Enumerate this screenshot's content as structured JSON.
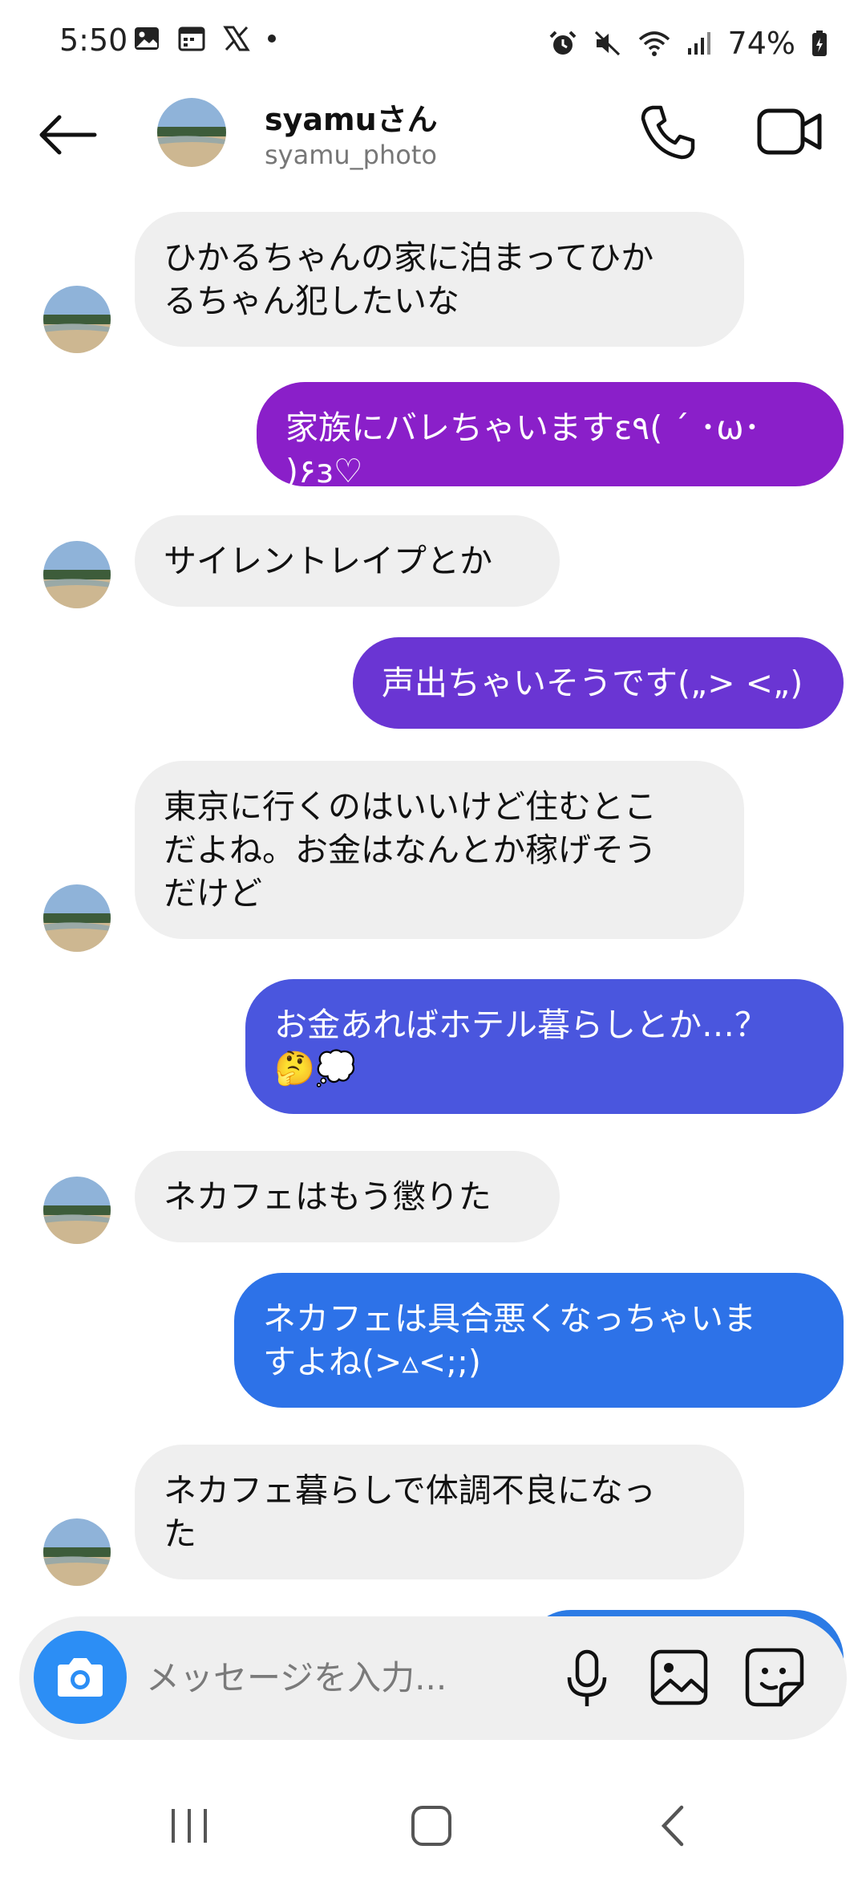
{
  "status_bar": {
    "time": "5:50",
    "battery": "74%",
    "icons_left": [
      "gallery-icon",
      "calendar-icon",
      "x-logo-icon",
      "notification-dot-icon"
    ],
    "icons_right": [
      "alarm-icon",
      "mute-icon",
      "wifi-icon",
      "signal-icon",
      "battery-icon"
    ]
  },
  "header": {
    "name": "syamuさん",
    "username": "syamu_photo"
  },
  "messages": [
    {
      "side": "in",
      "text": "ひかるちゃんの家に泊まってひか\nるちゃん犯したいな"
    },
    {
      "side": "out",
      "text": "家族にバレちゃいますε٩( ´ ･ω･ )۶з♡",
      "color": "#8a1fc9"
    },
    {
      "side": "in",
      "text": "サイレントレイプとか"
    },
    {
      "side": "out",
      "text": "声出ちゃいそうです(„> <„)",
      "color": "#6a35d3"
    },
    {
      "side": "in",
      "text": "東京に行くのはいいけど住むとこ\nだよね。お金はなんとか稼げそう\nだけど"
    },
    {
      "side": "out",
      "text": "お金あればホテル暮らしとか…？\n🤔💭",
      "color": "#4a56de"
    },
    {
      "side": "in",
      "text": "ネカフェはもう懲りた"
    },
    {
      "side": "out",
      "text": "ネカフェは具合悪くなっちゃいま\nすよね(>▵<;;)",
      "color": "#2d72e8"
    },
    {
      "side": "in",
      "text": "ネカフェ暮らしで体調不良になっ\nた"
    }
  ],
  "composer": {
    "placeholder": "メッセージを入力..."
  },
  "colors": {
    "incoming_bubble": "#efefef",
    "accent_blue": "#2c8ef5"
  }
}
